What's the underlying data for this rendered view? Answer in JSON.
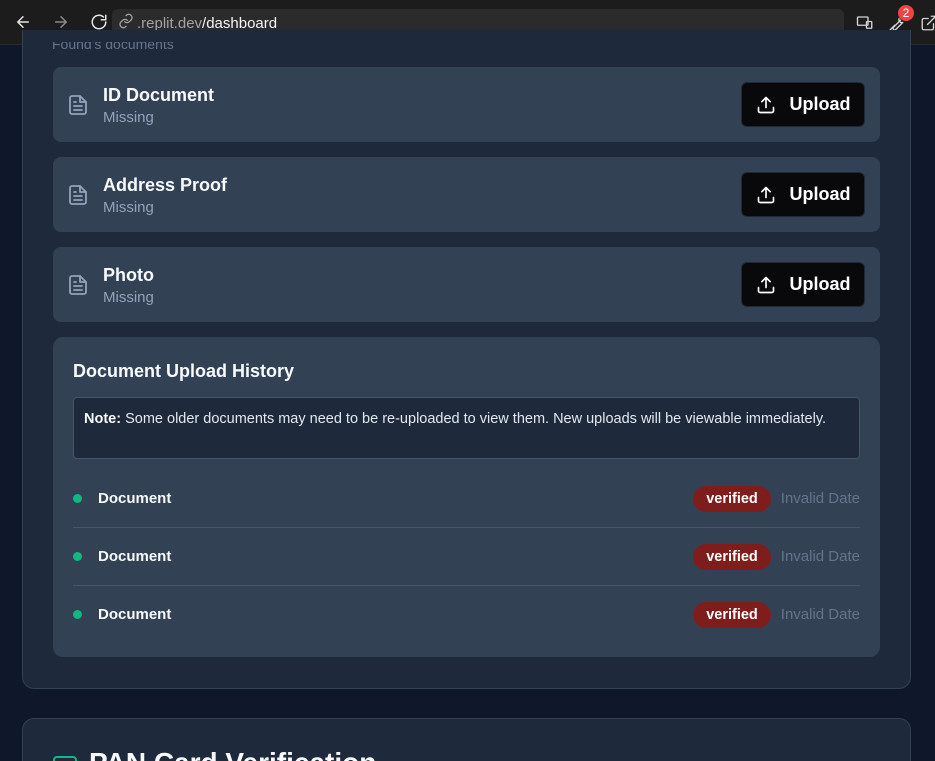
{
  "browser": {
    "host": ".replit.dev",
    "path": "/dashboard",
    "extension_badge": "2"
  },
  "section": {
    "cut_label": "Found's documents"
  },
  "documents": [
    {
      "title": "ID Document",
      "status": "Missing",
      "button": "Upload"
    },
    {
      "title": "Address Proof",
      "status": "Missing",
      "button": "Upload"
    },
    {
      "title": "Photo",
      "status": "Missing",
      "button": "Upload"
    }
  ],
  "history": {
    "title": "Document Upload History",
    "note_label": "Note:",
    "note_text": "Some older documents may need to be re-uploaded to view them. New uploads will be viewable immediately.",
    "items": [
      {
        "name": "Document",
        "status": "verified",
        "date": "Invalid Date"
      },
      {
        "name": "Document",
        "status": "verified",
        "date": "Invalid Date"
      },
      {
        "name": "Document",
        "status": "verified",
        "date": "Invalid Date"
      }
    ]
  },
  "next_section": {
    "title": "PAN Card Verification"
  },
  "colors": {
    "success_dot": "#10b981",
    "verified_pill": "#7f1d1d",
    "panel": "#334155"
  }
}
